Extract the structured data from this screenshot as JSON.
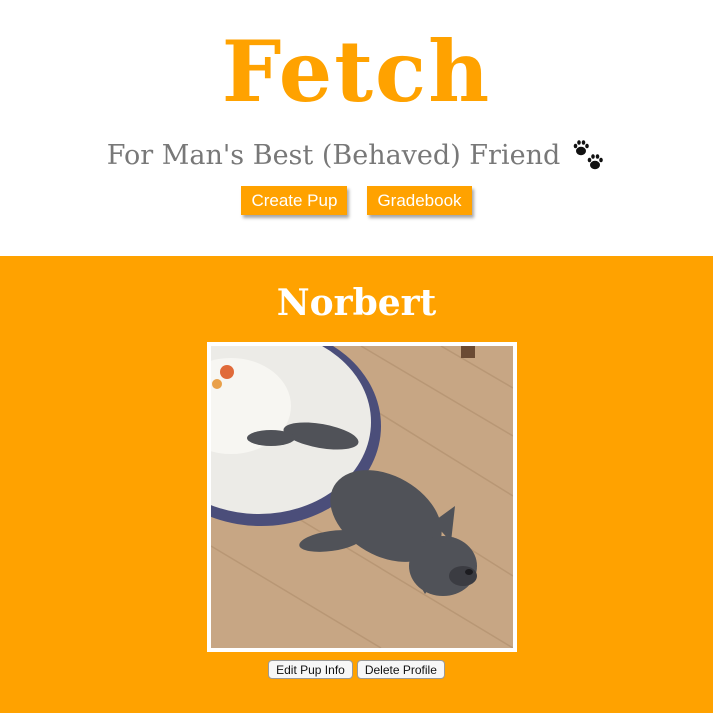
{
  "header": {
    "brand": "Fetch",
    "tagline": "For Man's Best (Behaved) Friend",
    "tagline_icon": "paw-prints-icon"
  },
  "nav": {
    "create_pup_label": "Create Pup",
    "gradebook_label": "Gradebook"
  },
  "pup": {
    "name": "Norbert",
    "photo_subject": "sleeping grey french bulldog puppy"
  },
  "actions": {
    "edit_label": "Edit Pup Info",
    "delete_label": "Delete Profile"
  },
  "colors": {
    "accent": "#ffa200",
    "tagline_gray": "#787878",
    "page_background": "#ffffff"
  }
}
